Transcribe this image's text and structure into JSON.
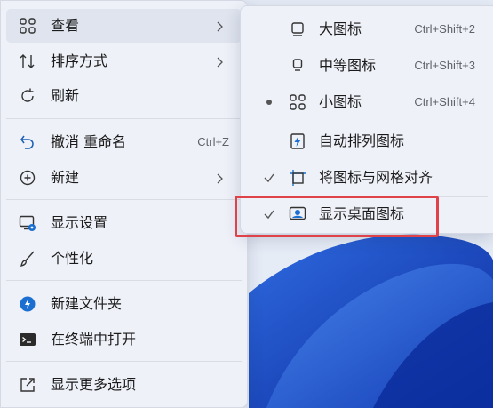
{
  "main_menu": {
    "items": [
      {
        "label": "查看",
        "icon": "grid-view-icon"
      },
      {
        "label": "排序方式",
        "icon": "sort-icon"
      },
      {
        "label": "刷新",
        "icon": "refresh-icon"
      },
      {
        "label": "撤消 重命名",
        "shortcut": "Ctrl+Z",
        "icon": "undo-icon"
      },
      {
        "label": "新建",
        "icon": "new-plus-icon"
      },
      {
        "label": "显示设置",
        "icon": "display-settings-icon"
      },
      {
        "label": "个性化",
        "icon": "personalize-brush-icon"
      },
      {
        "label": "新建文件夹",
        "icon": "new-folder-icon"
      },
      {
        "label": "在终端中打开",
        "icon": "terminal-icon"
      },
      {
        "label": "显示更多选项",
        "icon": "more-options-icon"
      }
    ]
  },
  "sub_menu": {
    "items": [
      {
        "label": "大图标",
        "shortcut": "Ctrl+Shift+2",
        "icon": "large-icons-icon",
        "selected": false
      },
      {
        "label": "中等图标",
        "shortcut": "Ctrl+Shift+3",
        "icon": "medium-icons-icon",
        "selected": false
      },
      {
        "label": "小图标",
        "shortcut": "Ctrl+Shift+4",
        "icon": "small-icons-icon",
        "selected": true
      },
      {
        "label": "自动排列图标",
        "icon": "auto-arrange-icon",
        "checked": false
      },
      {
        "label": "将图标与网格对齐",
        "icon": "align-grid-icon",
        "checked": true
      },
      {
        "label": "显示桌面图标",
        "icon": "show-desktop-icons-icon",
        "checked": true
      }
    ]
  },
  "colors": {
    "accent": "#0067c0",
    "highlight_box": "#e0424a",
    "menu_bg": "#eef1f8"
  }
}
